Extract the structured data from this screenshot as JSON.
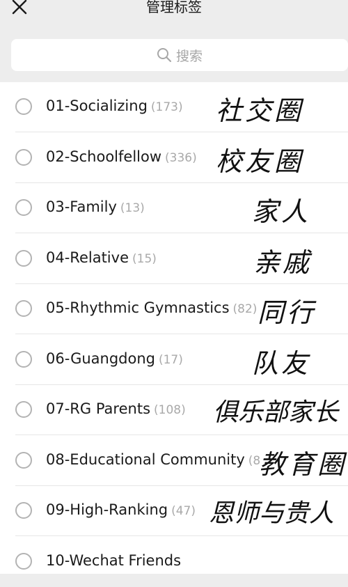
{
  "header": {
    "title": "管理标签"
  },
  "search": {
    "placeholder": "搜索"
  },
  "tags": [
    {
      "label": "01-Socializing",
      "count": "(173)",
      "note": "社交圈"
    },
    {
      "label": "02-Schoolfellow",
      "count": "(336)",
      "note": "校友圈"
    },
    {
      "label": "03-Family",
      "count": "(13)",
      "note": "家人"
    },
    {
      "label": "04-Relative",
      "count": "(15)",
      "note": "亲戚"
    },
    {
      "label": "05-Rhythmic Gymnastics",
      "count": "(82)",
      "note": "同行"
    },
    {
      "label": "06-Guangdong",
      "count": "(17)",
      "note": "队友"
    },
    {
      "label": "07-RG Parents",
      "count": "(108)",
      "note": "俱乐部家长"
    },
    {
      "label": "08-Educational Community",
      "count": "(8",
      "note": "教育圈"
    },
    {
      "label": "09-High-Ranking",
      "count": "(47)",
      "note": "恩师与贵人"
    },
    {
      "label": "10-Wechat Friends",
      "count": "",
      "note": ""
    }
  ]
}
